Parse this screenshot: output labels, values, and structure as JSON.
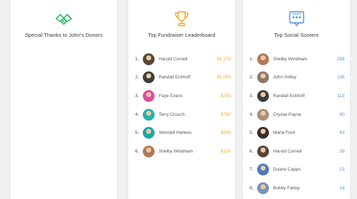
{
  "panels": {
    "donors": {
      "title": "Special Thanks to John's Donors",
      "icon": "handshake-icon",
      "color": "#2eb872"
    },
    "fundraisers": {
      "title": "Top Fundraiser Leaderboard",
      "icon": "trophy-icon",
      "color": "#f5a623",
      "items": [
        {
          "rank": "1.",
          "name": "Harold Cornell",
          "value": "$1,270",
          "avatar": "#5a4636"
        },
        {
          "rank": "2.",
          "name": "Randall Eckhoff",
          "value": "$1,000",
          "avatar": "#3e3e3e"
        },
        {
          "rank": "3.",
          "name": "Faye Evans",
          "value": "$750",
          "avatar": "#e04b9f"
        },
        {
          "rank": "4.",
          "name": "Terry Crouch",
          "value": "$750",
          "avatar": "#26b0b0"
        },
        {
          "rank": "5.",
          "name": "Wendell Harless",
          "value": "$545",
          "avatar": "#1fa7a7"
        },
        {
          "rank": "6.",
          "name": "Shelby Windham",
          "value": "$120",
          "avatar": "#b27a56"
        }
      ]
    },
    "social": {
      "title": "Top Social Scorers",
      "icon": "chat-screen-icon",
      "color": "#4a90d9",
      "items": [
        {
          "rank": "1.",
          "name": "Shelby Windham",
          "value": "258",
          "avatar": "#b27a56"
        },
        {
          "rank": "2.",
          "name": "John Solley",
          "value": "136",
          "avatar": "#8a7a6a"
        },
        {
          "rank": "3.",
          "name": "Randall Eckhoff",
          "value": "113",
          "avatar": "#3e3e3e"
        },
        {
          "rank": "4.",
          "name": "Crystal Payne",
          "value": "90",
          "avatar": "#a9927a"
        },
        {
          "rank": "5.",
          "name": "Marla Ford",
          "value": "83",
          "avatar": "#3a2e28"
        },
        {
          "rank": "6.",
          "name": "Harold Cornell",
          "value": "29",
          "avatar": "#5a4636"
        },
        {
          "rank": "7.",
          "name": "Duane Capps",
          "value": "23",
          "avatar": "#4a7ab8"
        },
        {
          "rank": "8.",
          "name": "Bobby Farley",
          "value": "18",
          "avatar": "#7a93b8"
        }
      ]
    }
  }
}
